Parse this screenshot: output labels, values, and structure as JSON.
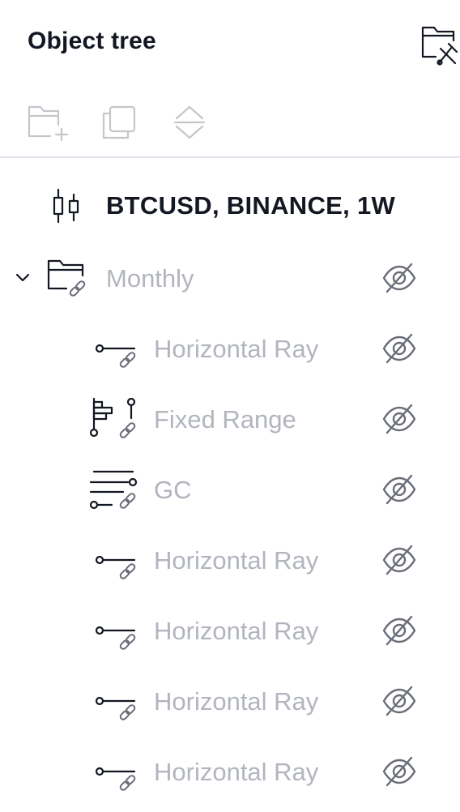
{
  "panel": {
    "title": "Object tree"
  },
  "toolbar": {
    "tools": [
      {
        "icon": "folder-plus-icon"
      },
      {
        "icon": "clone-icon"
      },
      {
        "icon": "move-up-down-icon"
      }
    ]
  },
  "symbol": {
    "label": "BTCUSD, BINANCE, 1W",
    "icon": "candlestick-icon"
  },
  "tree": {
    "group": {
      "label": "Monthly",
      "icon": "linked-folder-icon",
      "hidden": true
    },
    "items": [
      {
        "label": "Horizontal Ray",
        "icon": "horizontal-ray-icon",
        "hidden": true
      },
      {
        "label": "Fixed Range",
        "icon": "fixed-range-volume-profile-icon",
        "hidden": true
      },
      {
        "label": "GC",
        "icon": "horizontal-lines-icon",
        "hidden": true
      },
      {
        "label": "Horizontal Ray",
        "icon": "horizontal-ray-icon",
        "hidden": true
      },
      {
        "label": "Horizontal Ray",
        "icon": "horizontal-ray-icon",
        "hidden": true
      },
      {
        "label": "Horizontal Ray",
        "icon": "horizontal-ray-icon",
        "hidden": true
      },
      {
        "label": "Horizontal Ray",
        "icon": "horizontal-ray-icon",
        "hidden": true
      }
    ]
  },
  "colors": {
    "text_primary": "#131722",
    "text_hidden": "#b2b5be",
    "icon_disabled": "#c4c6cc",
    "divider": "#e0e3eb"
  }
}
